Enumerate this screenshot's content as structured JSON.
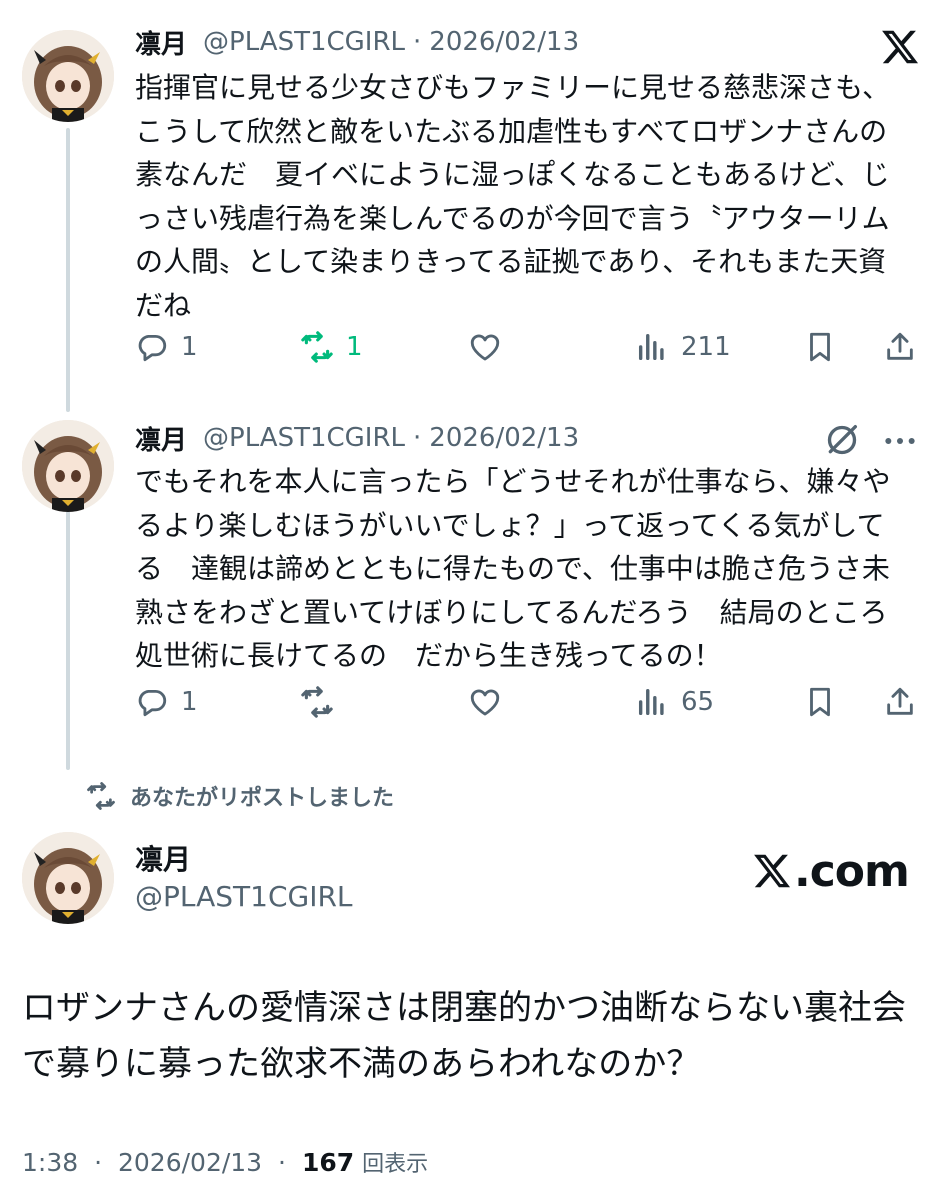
{
  "tweets": [
    {
      "name": "凛月",
      "handle": "@PLAST1CGIRL",
      "separator": "·",
      "date": "2026/02/13",
      "text": "指揮官に見せる少女さびもファミリーに見せる慈悲深さも、こうして欣然と敵をいたぶる加虐性もすべてロザンナさんの素なんだ　夏イベにように湿っぽくなることもあるけど、じっさい残虐行為を楽しんでるのが今回で言う〝アウターリムの人間〟として染まりきってる証拠であり、それもまた天資だね",
      "replies": "1",
      "reposts": "1",
      "likes": "",
      "views": "211",
      "reposted_by_me": true
    },
    {
      "name": "凛月",
      "handle": "@PLAST1CGIRL",
      "separator": "·",
      "date": "2026/02/13",
      "text": "でもそれを本人に言ったら「どうせそれが仕事なら、嫌々やるより楽しむほうがいいでしょ？」って返ってくる気がしてる　達観は諦めとともに得たもので、仕事中は脆さ危うさ未熟さをわざと置いてけぼりにしてるんだろう　結局のところ処世術に長けてるの　だから生き残ってるの！",
      "replies": "1",
      "reposts": "",
      "likes": "",
      "views": "65",
      "reposted_by_me": false
    }
  ],
  "repost_note": "あなたがリポストしました",
  "main_tweet": {
    "name": "凛月",
    "handle": "@PLAST1CGIRL",
    "text": "ロザンナさんの愛情深さは閉塞的かつ油断ならない裏社会で募りに募った欲求不満のあらわれなのか？",
    "time": "1:38",
    "separator": "·",
    "date": "2026/02/13",
    "views": "167",
    "views_label": "回表示"
  },
  "branding": {
    "watermark": "X.com",
    "watermark_rest": ".com"
  },
  "icons": {
    "top_right": "x-logo-icon",
    "second_tweet_right": [
      "grok-icon",
      "more-icon"
    ],
    "actions": [
      "reply-icon",
      "repost-icon",
      "like-icon",
      "views-icon",
      "bookmark-icon",
      "share-icon"
    ]
  },
  "colors": {
    "text": "#0f1419",
    "secondary": "#536471",
    "repost_active": "#00ba7c",
    "thread_line": "#cfd9de"
  }
}
